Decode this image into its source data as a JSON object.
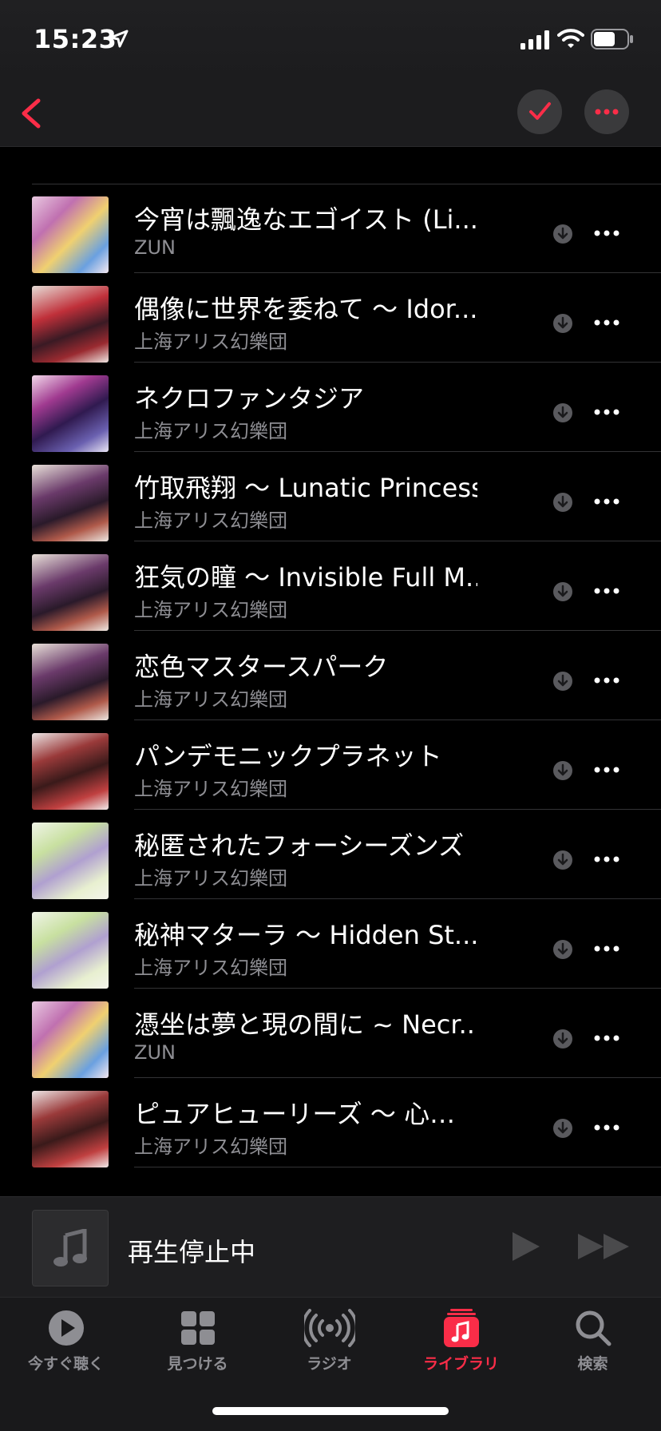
{
  "status_bar": {
    "time": "15:23"
  },
  "header": {
    "back_icon": "chevron-left-icon",
    "select_icon": "checkmark-icon",
    "more_icon": "ellipsis-icon"
  },
  "songs": [
    {
      "title": "今宵は飄逸なエゴイスト (Li...",
      "artist": "ZUN",
      "art": "a"
    },
    {
      "title": "偶像に世界を委ねて 〜 Idor...",
      "artist": "上海アリス幻樂団",
      "art": "b"
    },
    {
      "title": "ネクロファンタジア",
      "artist": "上海アリス幻樂団",
      "art": "c"
    },
    {
      "title": "竹取飛翔 〜 Lunatic Princess",
      "artist": "上海アリス幻樂団",
      "art": "d"
    },
    {
      "title": "狂気の瞳 〜 Invisible Full M...",
      "artist": "上海アリス幻樂団",
      "art": "d"
    },
    {
      "title": "恋色マスタースパーク",
      "artist": "上海アリス幻樂団",
      "art": "d"
    },
    {
      "title": "パンデモニックプラネット",
      "artist": "上海アリス幻樂団",
      "art": "e"
    },
    {
      "title": "秘匿されたフォーシーズンズ",
      "artist": "上海アリス幻樂団",
      "art": "f"
    },
    {
      "title": "秘神マターラ 〜 Hidden St...",
      "artist": "上海アリス幻樂団",
      "art": "f"
    },
    {
      "title": "憑坐は夢と現の間に ~ Necr...",
      "artist": "ZUN",
      "art": "a"
    },
    {
      "title": "ピュアヒューリーズ 〜 心…",
      "artist": "上海アリス幻樂団",
      "art": "e"
    }
  ],
  "mini_player": {
    "status": "再生停止中"
  },
  "tabs": [
    {
      "label": "今すぐ聴く",
      "icon": "play-circle-icon",
      "active": false
    },
    {
      "label": "見つける",
      "icon": "grid-icon",
      "active": false
    },
    {
      "label": "ラジオ",
      "icon": "radio-icon",
      "active": false
    },
    {
      "label": "ライブラリ",
      "icon": "music-library-icon",
      "active": true
    },
    {
      "label": "検索",
      "icon": "search-icon",
      "active": false
    }
  ],
  "colors": {
    "accent": "#fa2d48",
    "background": "#000000",
    "secondary_text": "#8e8e93"
  }
}
